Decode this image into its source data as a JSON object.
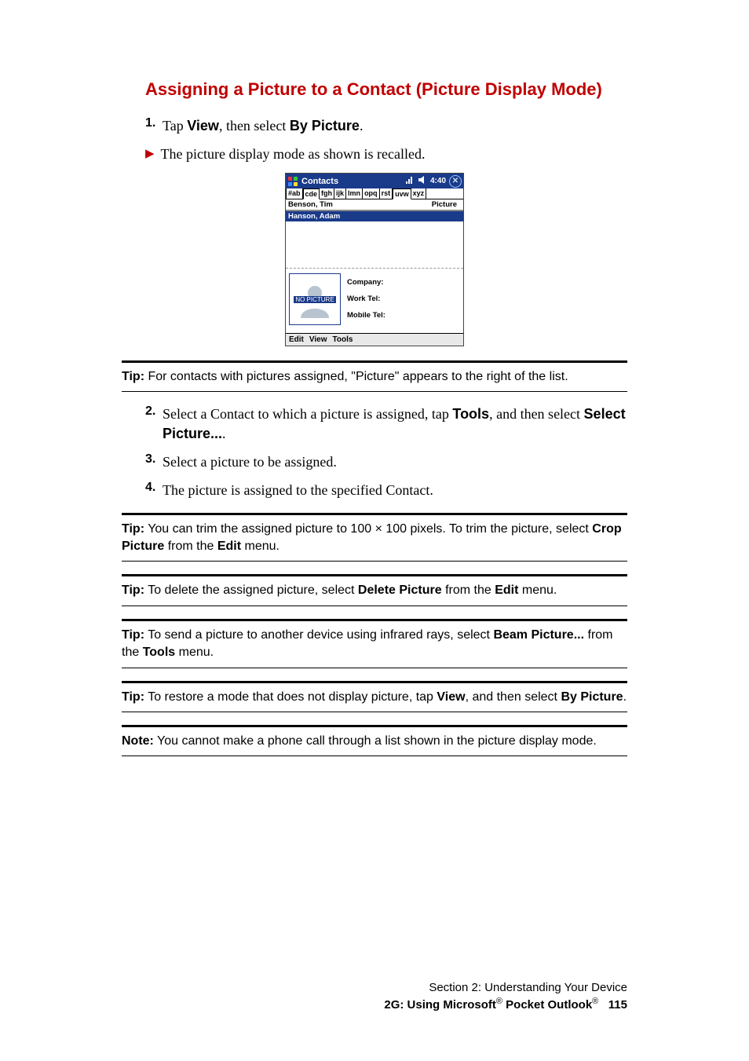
{
  "heading": "Assigning a Picture to a Contact (Picture Display Mode)",
  "step1": {
    "num": "1.",
    "pre": "Tap ",
    "b1": "View",
    "mid": ", then select ",
    "b2": "By Picture",
    "post": "."
  },
  "bullet1": "The picture display mode as shown is recalled.",
  "screenshot": {
    "title": "Contacts",
    "time": "4:40",
    "tabs": [
      "#ab",
      "cde",
      "fgh",
      "ijk",
      "lmn",
      "opq",
      "rst",
      "uvw",
      "xyz"
    ],
    "col_name": "Benson, Tim",
    "col_pic": "Picture",
    "selected_row": "Hanson, Adam",
    "no_picture": "NO PICTURE",
    "fields": {
      "company": "Company:",
      "work": "Work Tel:",
      "mobile": "Mobile Tel:"
    },
    "menu": [
      "Edit",
      "View",
      "Tools"
    ]
  },
  "tip1": {
    "lead": "Tip:",
    "body_pre": " For contacts with pictures assigned, \"Picture\" appears to the right of the list."
  },
  "step2": {
    "num": "2.",
    "pre": "Select a Contact to which a picture is assigned, tap ",
    "b1": "Tools",
    "mid": ", and then select ",
    "b2": "Select Picture...",
    "post": "."
  },
  "step3": {
    "num": "3.",
    "txt": "Select a picture to be assigned."
  },
  "step4": {
    "num": "4.",
    "txt": " The picture is assigned to the specified Contact."
  },
  "tip2": {
    "lead": "Tip:",
    "pre": " You can trim the assigned picture to 100 ",
    "times": "×",
    "mid": " 100 pixels. To trim the picture, select ",
    "b1": "Crop Picture",
    "mid2": " from the ",
    "b2": "Edit",
    "post": " menu."
  },
  "tip3": {
    "lead": "Tip:",
    "pre": " To delete the assigned picture, select ",
    "b1": "Delete Picture",
    "mid": " from the ",
    "b2": "Edit",
    "post": " menu."
  },
  "tip4": {
    "lead": "Tip:",
    "pre": " To send a picture to another device using infrared rays, select ",
    "b1": "Beam Picture...",
    "mid": " from the ",
    "b2": "Tools",
    "post": " menu."
  },
  "tip5": {
    "lead": "Tip:",
    "pre": " To restore a mode that does not display picture, tap ",
    "b1": "View",
    "mid": ", and then select ",
    "b2": "By Picture",
    "post": "."
  },
  "note": {
    "lead": "Note:",
    "body": " You cannot make a phone call through a list shown in the picture display mode."
  },
  "footer": {
    "line1": "Section 2: Understanding Your Device",
    "line2_a": "2G: Using Microsoft",
    "line2_b": " Pocket Outlook",
    "page": "115",
    "reg": "®"
  }
}
